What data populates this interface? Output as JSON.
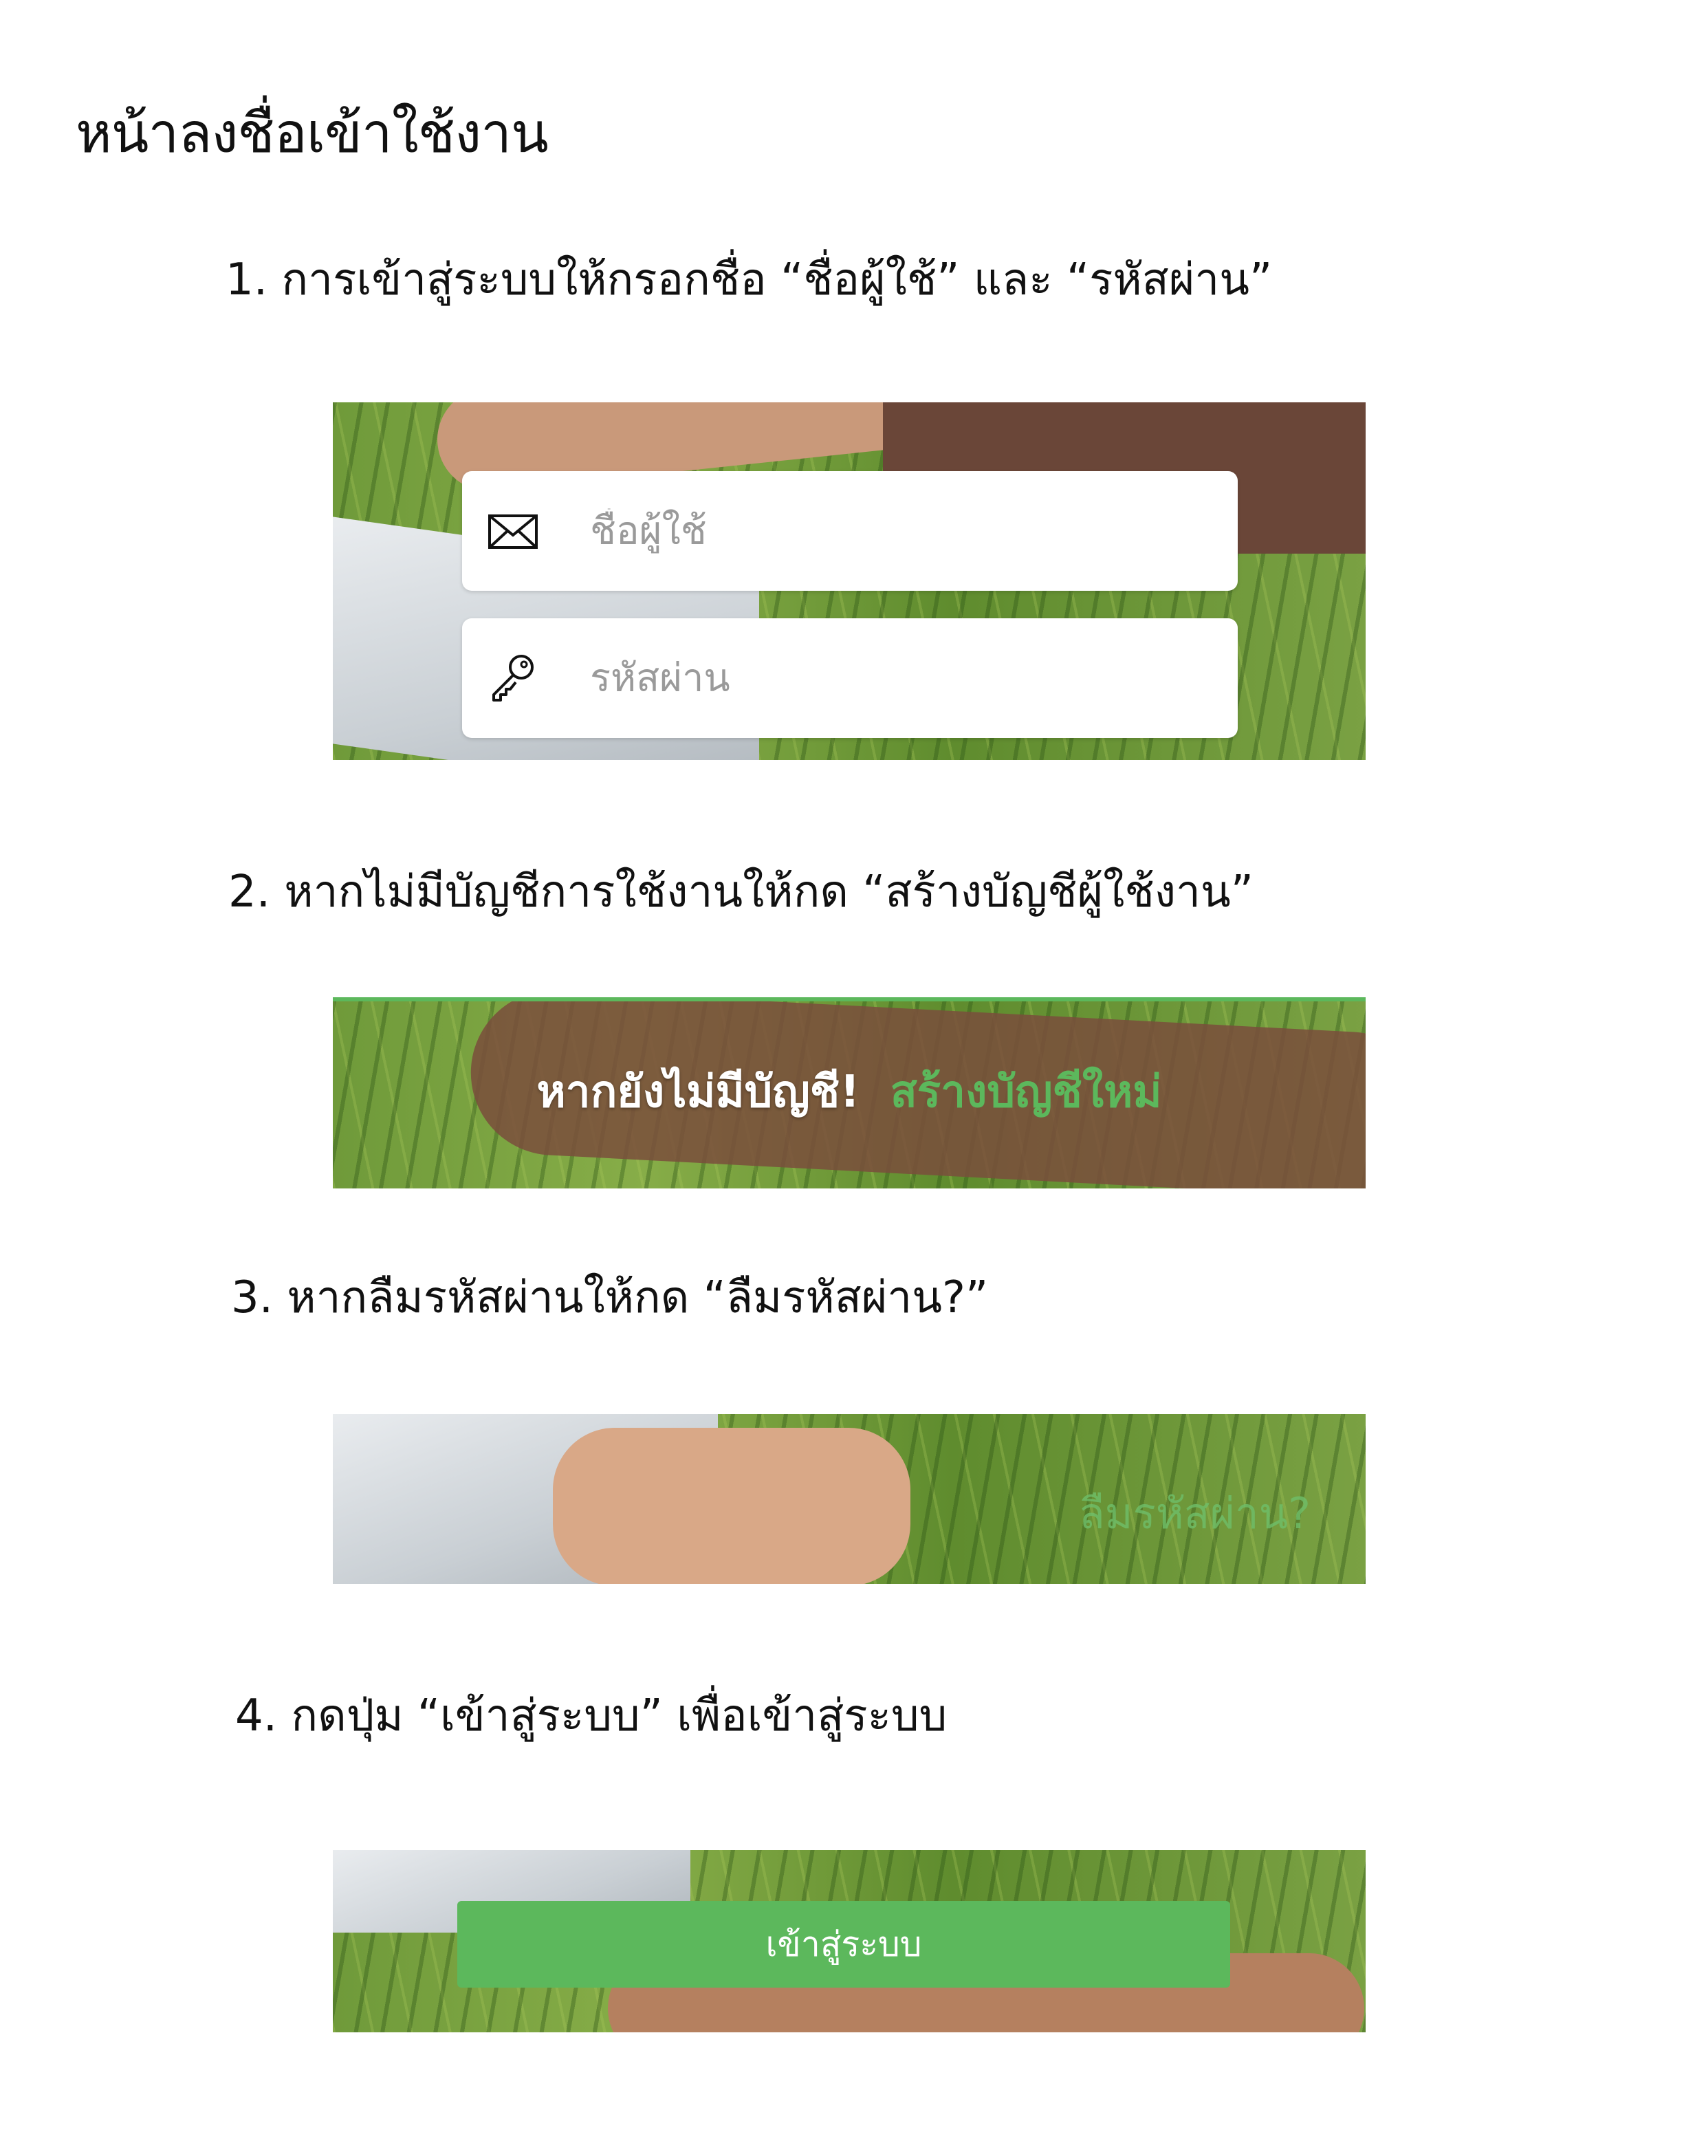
{
  "title": "หน้าลงชื่อเข้าใช้งาน",
  "steps": [
    "1. การเข้าสู่ระบบให้กรอกชื่อ “ชื่อผู้ใช้” และ “รหัสผ่าน”",
    "2. หากไม่มีบัญชีการใช้งานให้กด “สร้างบัญชีผู้ใช้งาน”",
    "3. หากลืมรหัสผ่านให้กด “ลืมรหัสผ่าน?”",
    "4. กดปุ่ม “เข้าสู่ระบบ” เพื่อเข้าสู่ระบบ"
  ],
  "login_form": {
    "username_placeholder": "ชื่อผู้ใช้",
    "password_placeholder": "รหัสผ่าน",
    "username_icon": "envelope-icon",
    "password_icon": "key-icon"
  },
  "signup": {
    "prompt": "หากยังไม่มีบัญชี!",
    "link": "สร้างบัญชีใหม่"
  },
  "forgot_password": "ลืมรหัสผ่าน?",
  "login_button": "เข้าสู่ระบบ",
  "colors": {
    "accent_green": "#5cb85c",
    "placeholder_gray": "#9a9a9a"
  }
}
